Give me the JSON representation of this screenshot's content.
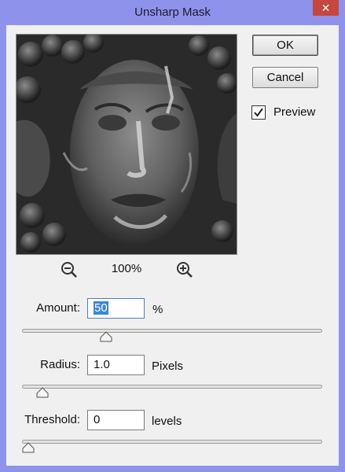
{
  "window": {
    "title": "Unsharp Mask",
    "close_label": "✕"
  },
  "buttons": {
    "ok": "OK",
    "cancel": "Cancel"
  },
  "preview": {
    "label": "Preview",
    "checked": true,
    "zoom_level": "100%"
  },
  "controls": {
    "amount": {
      "label": "Amount:",
      "value": "50",
      "unit": "%",
      "slider_fraction": 0.27
    },
    "radius": {
      "label": "Radius:",
      "value": "1.0",
      "unit": "Pixels",
      "slider_fraction": 0.05
    },
    "threshold": {
      "label": "Threshold:",
      "value": "0",
      "unit": "levels",
      "slider_fraction": 0.0
    }
  },
  "icons": {
    "zoom_out": "zoom-out-icon",
    "zoom_in": "zoom-in-icon",
    "check": "check-icon"
  }
}
